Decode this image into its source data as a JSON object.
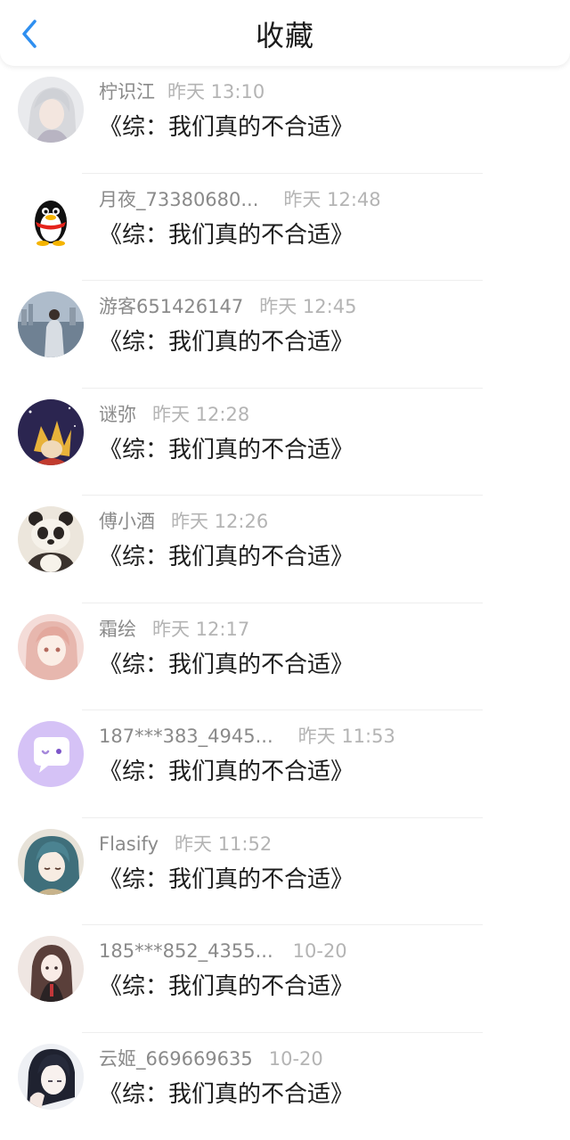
{
  "header": {
    "title": "收藏",
    "back_icon": "chevron-left-icon",
    "accent_color": "#2f8ff0"
  },
  "list": {
    "items": [
      {
        "name": "柠识江",
        "time": "昨天 13:10",
        "title": "《综：我们真的不合适》",
        "avatar": "anime-white-hair-avatar"
      },
      {
        "name": "月夜_73380680...",
        "time": "昨天 12:48",
        "title": "《综：我们真的不合适》",
        "avatar": "qq-penguin-avatar"
      },
      {
        "name": "游客651426147",
        "time": "昨天 12:45",
        "title": "《综：我们真的不合适》",
        "avatar": "photo-man-city-avatar"
      },
      {
        "name": "谜弥",
        "time": "昨天 12:28",
        "title": "《综：我们真的不合适》",
        "avatar": "anime-golden-hair-avatar"
      },
      {
        "name": "傅小酒",
        "time": "昨天 12:26",
        "title": "《综：我们真的不合适》",
        "avatar": "panda-avatar"
      },
      {
        "name": "霜绘",
        "time": "昨天 12:17",
        "title": "《综：我们真的不合适》",
        "avatar": "anime-pink-girl-avatar"
      },
      {
        "name": "187***383_4945...",
        "time": "昨天 11:53",
        "title": "《综：我们真的不合适》",
        "avatar": "purple-chat-bubble-avatar"
      },
      {
        "name": "Flasify",
        "time": "昨天 11:52",
        "title": "《综：我们真的不合适》",
        "avatar": "anime-teal-hair-avatar"
      },
      {
        "name": "185***852_4355...",
        "time": "10-20",
        "title": "《综：我们真的不合适》",
        "avatar": "anime-dark-hair-girl-avatar"
      },
      {
        "name": "云姬_669669635",
        "time": "10-20",
        "title": "《综：我们真的不合适》",
        "avatar": "anime-black-hair-boy-avatar"
      }
    ]
  }
}
